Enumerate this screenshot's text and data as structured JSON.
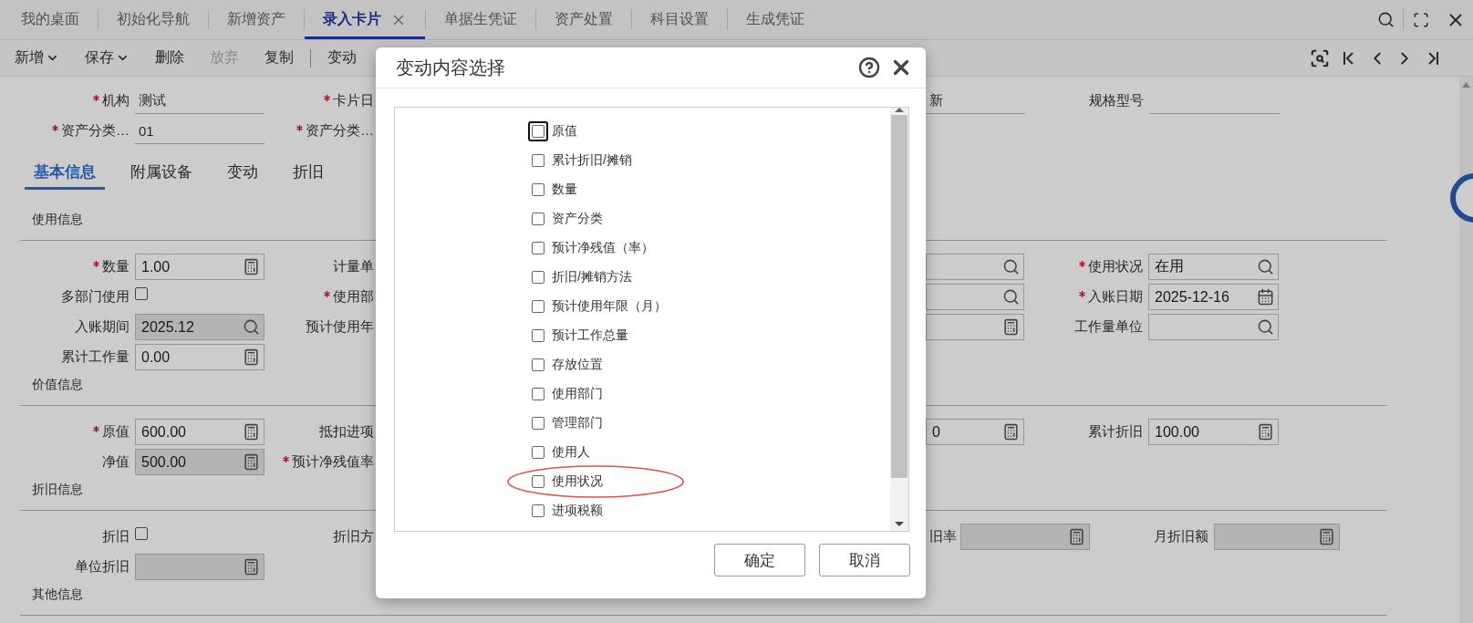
{
  "tabs": [
    {
      "label": "我的桌面",
      "selected": false,
      "closable": false
    },
    {
      "label": "初始化导航",
      "selected": false,
      "closable": false
    },
    {
      "label": "新增资产",
      "selected": false,
      "closable": false
    },
    {
      "label": "录入卡片",
      "selected": true,
      "closable": true
    },
    {
      "label": "单据生凭证",
      "selected": false,
      "closable": false
    },
    {
      "label": "资产处置",
      "selected": false,
      "closable": false
    },
    {
      "label": "科目设置",
      "selected": false,
      "closable": false
    },
    {
      "label": "生成凭证",
      "selected": false,
      "closable": false
    }
  ],
  "toolbar": [
    {
      "label": "新增",
      "dropdown": true,
      "disabled": false,
      "separator_before": false
    },
    {
      "label": "保存",
      "dropdown": true,
      "disabled": false,
      "separator_before": false
    },
    {
      "label": "删除",
      "dropdown": false,
      "disabled": false,
      "separator_before": false
    },
    {
      "label": "放弃",
      "dropdown": false,
      "disabled": true,
      "separator_before": false
    },
    {
      "label": "复制",
      "dropdown": false,
      "disabled": false,
      "separator_before": false
    },
    {
      "label": "变动",
      "dropdown": false,
      "disabled": false,
      "separator_before": true
    }
  ],
  "header_rows": [
    {
      "field": {
        "label": "机构",
        "required": true,
        "value": "测试"
      },
      "label_2": {
        "text": "卡片日",
        "required": true
      },
      "field_3": {
        "value": "新"
      },
      "field_4": {
        "label": "规格型号",
        "required": false
      }
    },
    {
      "field": {
        "label": "资产分类…",
        "required": true,
        "value": "01"
      },
      "label_2": {
        "text": "资产分类…",
        "required": true
      }
    }
  ],
  "detail_tabs": [
    {
      "label": "基本信息",
      "selected": true
    },
    {
      "label": "附属设备",
      "selected": false
    },
    {
      "label": "变动",
      "selected": false
    },
    {
      "label": "折旧",
      "selected": false
    }
  ],
  "sections": [
    {
      "title": "使用信息",
      "kind": "standard",
      "rows": [
        {
          "field": {
            "label": "数量",
            "required": true,
            "kind": "calculator",
            "value": "1.00",
            "readonly": false
          },
          "label_2": {
            "text": "计量单",
            "required": false
          },
          "field_3": {
            "kind": "lookup",
            "readonly": false
          },
          "field_4": {
            "label": "使用状况",
            "required": true,
            "kind": "lookup",
            "value": "在用",
            "readonly": false
          }
        },
        {
          "field": {
            "label": "多部门使用",
            "required": false,
            "kind": "checkbox",
            "checked": false
          },
          "label_2": {
            "text": "使用部",
            "required": true
          },
          "field_3": {
            "kind": "lookup",
            "readonly": false
          },
          "field_4": {
            "label": "入账日期",
            "required": true,
            "kind": "date",
            "value": "2025-12-16",
            "readonly": false
          }
        },
        {
          "field": {
            "label": "入账期间",
            "required": false,
            "kind": "lookup",
            "value": "2025.12",
            "readonly": true
          },
          "label_2": {
            "text": "预计使用年",
            "required": false
          },
          "field_3": {
            "kind": "calculator",
            "readonly": false
          },
          "field_4": {
            "label": "工作量单位",
            "required": false,
            "kind": "lookup",
            "readonly": false
          }
        },
        {
          "field": {
            "label": "累计工作量",
            "required": false,
            "kind": "calculator",
            "value": "0.00",
            "readonly": false
          }
        }
      ]
    },
    {
      "title": "价值信息",
      "kind": "standard",
      "rows": [
        {
          "field": {
            "label": "原值",
            "required": true,
            "kind": "calculator",
            "value": "600.00",
            "readonly": false
          },
          "label_2": {
            "text": "抵扣进项",
            "required": false
          },
          "field_3": {
            "kind": "calculator",
            "value": "0",
            "readonly": false
          },
          "field_4": {
            "label": "累计折旧",
            "required": false,
            "kind": "calculator",
            "value": "100.00",
            "readonly": false
          }
        },
        {
          "field": {
            "label": "净值",
            "required": false,
            "kind": "calculator",
            "value": "500.00",
            "readonly": true
          },
          "label_2": {
            "text": "预计净残值率",
            "required": true
          }
        }
      ]
    },
    {
      "title": "折旧信息",
      "kind": "depreciation",
      "rows": [
        {
          "field": {
            "label": "折旧",
            "required": false,
            "kind": "checkbox",
            "checked": false
          },
          "label_2": {
            "text": "折旧方",
            "required": false
          },
          "field_3": {
            "label": "旧率",
            "kind": "calculator",
            "readonly": true
          },
          "field_4": {
            "label": "月折旧额",
            "required": false,
            "kind": "calculator",
            "readonly": true
          }
        },
        {
          "field": {
            "label": "单位折旧",
            "required": false,
            "kind": "calculator",
            "readonly": true
          }
        }
      ]
    },
    {
      "title": "其他信息"
    }
  ],
  "dialog": {
    "title": "变动内容选择",
    "items": [
      {
        "label": "原值",
        "checked": false,
        "focused": true,
        "highlighted": false
      },
      {
        "label": "累计折旧/摊销",
        "checked": false,
        "focused": false,
        "highlighted": false
      },
      {
        "label": "数量",
        "checked": false,
        "focused": false,
        "highlighted": false
      },
      {
        "label": "资产分类",
        "checked": false,
        "focused": false,
        "highlighted": false
      },
      {
        "label": "预计净残值（率）",
        "checked": false,
        "focused": false,
        "highlighted": false
      },
      {
        "label": "折旧/摊销方法",
        "checked": false,
        "focused": false,
        "highlighted": false
      },
      {
        "label": "预计使用年限（月）",
        "checked": false,
        "focused": false,
        "highlighted": false
      },
      {
        "label": "预计工作总量",
        "checked": false,
        "focused": false,
        "highlighted": false
      },
      {
        "label": "存放位置",
        "checked": false,
        "focused": false,
        "highlighted": false
      },
      {
        "label": "使用部门",
        "checked": false,
        "focused": false,
        "highlighted": false
      },
      {
        "label": "管理部门",
        "checked": false,
        "focused": false,
        "highlighted": false
      },
      {
        "label": "使用人",
        "checked": false,
        "focused": false,
        "highlighted": false
      },
      {
        "label": "使用状况",
        "checked": false,
        "focused": false,
        "highlighted": true
      },
      {
        "label": "进项税额",
        "checked": false,
        "focused": false,
        "highlighted": false
      }
    ],
    "buttons": [
      "确定",
      "取消"
    ]
  }
}
